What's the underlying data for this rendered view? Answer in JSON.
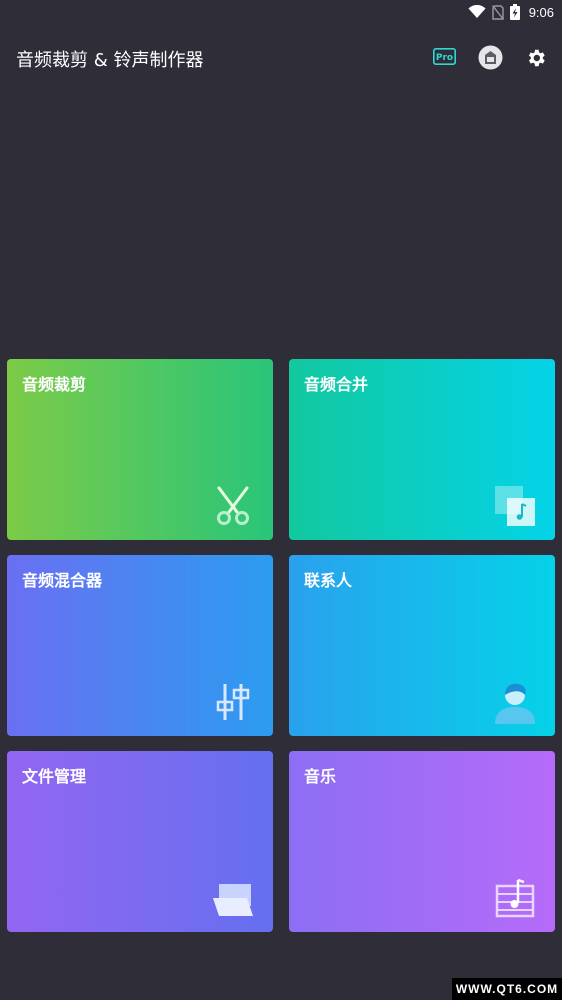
{
  "status_bar": {
    "time": "9:06",
    "icons": [
      "wifi-icon",
      "no-sim-icon",
      "battery-charging-icon"
    ]
  },
  "app_bar": {
    "title": "音频裁剪 & 铃声制作器",
    "pro_label": "Pro",
    "actions": [
      "pro-badge-icon",
      "vip-icon",
      "gear-icon"
    ]
  },
  "cards": [
    {
      "label": "音频裁剪",
      "icon": "scissors-icon"
    },
    {
      "label": "音频合并",
      "icon": "merge-audio-icon"
    },
    {
      "label": "音频混合器",
      "icon": "mixer-sliders-icon"
    },
    {
      "label": "联系人",
      "icon": "person-icon"
    },
    {
      "label": "文件管理",
      "icon": "folder-icon"
    },
    {
      "label": "音乐",
      "icon": "music-list-icon"
    }
  ],
  "watermark": "WWW.QT6.COM",
  "colors": {
    "background": "#2e2d38",
    "trim": [
      "#7ccb47",
      "#29c57a"
    ],
    "merge": [
      "#12c89e",
      "#04d3e8"
    ],
    "mixer": [
      "#6a6ff2",
      "#2b9cf0"
    ],
    "contacts": [
      "#2aa1ee",
      "#05d2e8"
    ],
    "files": [
      "#9366f1",
      "#656ff0"
    ],
    "music": [
      "#8c6ef4",
      "#b56bf9"
    ]
  }
}
